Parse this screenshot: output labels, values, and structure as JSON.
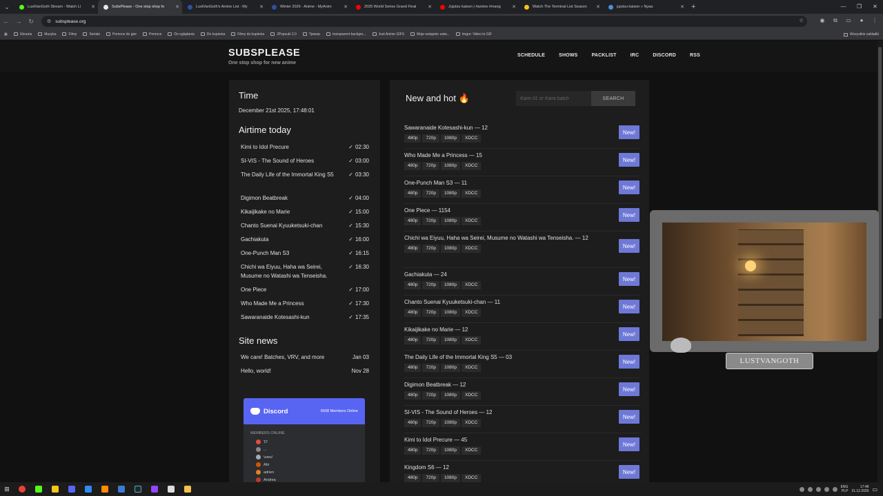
{
  "browser": {
    "tabs": [
      {
        "title": "LustVanGoth Stream - Watch Li",
        "color": "#53fc18"
      },
      {
        "title": "SubsPlease - One stop shop fo",
        "color": "#e8e8e8",
        "active": true
      },
      {
        "title": "LustVanGoth's Anime List - My",
        "color": "#2e51a2"
      },
      {
        "title": "Winter 2026 - Anime - MyAnim",
        "color": "#2e51a2"
      },
      {
        "title": "2025 World Series Grand Final",
        "color": "#ff0000"
      },
      {
        "title": "Jujutsu kaisen | #anime #mang",
        "color": "#ff0000"
      },
      {
        "title": "Watch The Terminal List Season",
        "color": "#f5c518"
      },
      {
        "title": "jujutsu kaisen » Nyaa",
        "color": "#4a90d9"
      }
    ],
    "url": "subsplease.org",
    "bookmarks": [
      "Ubrania",
      "Muzyka",
      "Filmy",
      "Seriale",
      "Pomoce do gier",
      "Pomoce",
      "Do oglądania",
      "Do kupienia",
      "Filmy do kupienia",
      "JPopsuki 2.0",
      "Трекер",
      "transparent backgro...",
      "Just Anime GIFS",
      "Moje wstępnie zatw...",
      "Imgur: Video to GIF"
    ],
    "other_bookmarks": "Wszystkie zakładki"
  },
  "site": {
    "logo": "SUBSPLEASE",
    "tagline": "One stop shop for new anime",
    "nav": [
      "SCHEDULE",
      "SHOWS",
      "PACKLIST",
      "IRC",
      "DISCORD",
      "RSS"
    ],
    "time_heading": "Time",
    "time_value": "December 21st 2025, 17:48:01",
    "airtime_heading": "Airtime today",
    "airtime": [
      {
        "name": "Kimi to Idol Precure",
        "time": "02:30"
      },
      {
        "name": "SI-VIS - The Sound of Heroes",
        "time": "03:00"
      },
      {
        "name": "The Daily Life of the Immortal King S5",
        "time": "03:30"
      },
      {
        "name": "Digimon Beatbreak",
        "time": "04:00"
      },
      {
        "name": "Kikaijikake no Marie",
        "time": "15:00"
      },
      {
        "name": "Chanto Suenai Kyuuketsuki-chan",
        "time": "15:30"
      },
      {
        "name": "Gachiakuta",
        "time": "16:00"
      },
      {
        "name": "One-Punch Man S3",
        "time": "16:15"
      },
      {
        "name": "Chichi wa Eiyuu, Haha wa Seirei, Musume no Watashi wa Tenseisha.",
        "time": "16:30"
      },
      {
        "name": "One Piece",
        "time": "17:00"
      },
      {
        "name": "Who Made Me a Princess",
        "time": "17:30"
      },
      {
        "name": "Sawaranaide Kotesashi-kun",
        "time": "17:35"
      }
    ],
    "news_heading": "Site news",
    "news": [
      {
        "title": "We care! Batches, VRV, and more",
        "date": "Jan 03"
      },
      {
        "title": "Hello, world!",
        "date": "Nov 28"
      }
    ],
    "discord": {
      "brand": "Discord",
      "online": "6508 Members Online",
      "members_label": "MEMBERS ONLINE",
      "members": [
        "'D'",
        "...",
        "\\uwu/",
        "Abi",
        "adrien",
        "Andrea"
      ]
    },
    "new_and_hot": "New and hot",
    "search_placeholder": "Kami 01 or Kami batch",
    "search_button": "SEARCH",
    "new_label": "New!",
    "releases": [
      {
        "title": "Sawaranaide Kotesashi-kun — 12",
        "res": [
          "480p",
          "720p",
          "1080p",
          "XDCC"
        ]
      },
      {
        "title": "Who Made Me a Princess — 15",
        "res": [
          "480p",
          "720p",
          "1080p",
          "XDCC"
        ]
      },
      {
        "title": "One-Punch Man S3 — 11",
        "res": [
          "480p",
          "720p",
          "1080p",
          "XDCC"
        ]
      },
      {
        "title": "One Piece — 1154",
        "res": [
          "480p",
          "720p",
          "1080p",
          "XDCC"
        ]
      },
      {
        "title": "Chichi wa Eiyuu, Haha wa Seirei, Musume no Watashi wa Tenseisha. — 12",
        "res": [
          "480p",
          "720p",
          "1080p",
          "XDCC"
        ]
      },
      {
        "title": "Gachiakuta — 24",
        "res": [
          "480p",
          "720p",
          "1080p",
          "XDCC"
        ]
      },
      {
        "title": "Chanto Suenai Kyuuketsuki-chan — 11",
        "res": [
          "480p",
          "720p",
          "1080p",
          "XDCC"
        ]
      },
      {
        "title": "Kikaijikake no Marie — 12",
        "res": [
          "480p",
          "720p",
          "1080p",
          "XDCC"
        ]
      },
      {
        "title": "The Daily Life of the Immortal King S5 — 03",
        "res": [
          "480p",
          "720p",
          "1080p",
          "XDCC"
        ]
      },
      {
        "title": "Digimon Beatbreak — 12",
        "res": [
          "480p",
          "720p",
          "1080p",
          "XDCC"
        ]
      },
      {
        "title": "SI-VIS - The Sound of Heroes — 12",
        "res": [
          "480p",
          "720p",
          "1080p",
          "XDCC"
        ]
      },
      {
        "title": "Kimi to Idol Precure — 45",
        "res": [
          "480p",
          "720p",
          "1080p",
          "XDCC"
        ]
      },
      {
        "title": "Kingdom S6 — 12",
        "res": [
          "480p",
          "720p",
          "1080p",
          "XDCC"
        ]
      }
    ]
  },
  "overlay": {
    "nameplate": "LUSTVANGOTH"
  },
  "taskbar": {
    "lang": "ENG",
    "lang2": "PLP",
    "time": "17:48",
    "date": "21.12.2025"
  }
}
